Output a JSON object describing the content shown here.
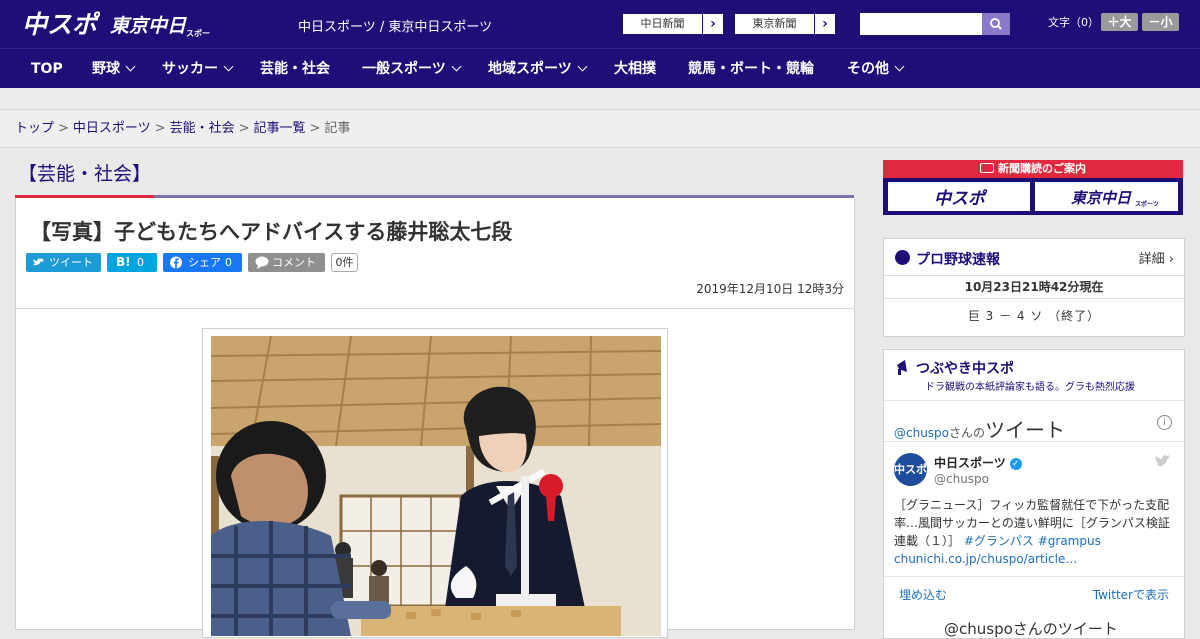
{
  "header": {
    "logo_chuspo": "中スポ",
    "logo_tokyo": "東京中日",
    "logo_tokyo_sub": "スポーツ",
    "site_title": "中日スポーツ / 東京中日スポーツ",
    "paper_buttons": [
      {
        "label": "中日新聞"
      },
      {
        "label": "東京新聞"
      }
    ],
    "search_placeholder": "",
    "font_size_label": "文字（0）",
    "font_larger": "＋大",
    "font_smaller": "－小"
  },
  "nav": {
    "items": [
      {
        "label": "TOP",
        "dropdown": false
      },
      {
        "label": "野球",
        "dropdown": true
      },
      {
        "label": "サッカー",
        "dropdown": true
      },
      {
        "label": "芸能・社会",
        "dropdown": false
      },
      {
        "label": "一般スポーツ",
        "dropdown": true
      },
      {
        "label": "地域スポーツ",
        "dropdown": true
      },
      {
        "label": "大相撲",
        "dropdown": false
      },
      {
        "label": "競馬・ボート・競輪",
        "dropdown": false
      },
      {
        "label": "その他",
        "dropdown": true
      }
    ]
  },
  "breadcrumb": {
    "items": [
      "トップ",
      "中日スポーツ",
      "芸能・社会",
      "記事一覧"
    ],
    "current": "記事"
  },
  "section": {
    "title": "【芸能・社会】"
  },
  "article": {
    "title": "【写真】子どもたちへアドバイスする藤井聡太七段",
    "share": {
      "twitter": "ツイート",
      "hatena": "B!",
      "hatena_count": "0",
      "facebook": "シェア",
      "facebook_count": "0",
      "comment": "コメント",
      "comment_count": "0件"
    },
    "date": "2019年12月10日 12時3分"
  },
  "sidebar": {
    "subscription_header": "新聞購読のご案内",
    "subscription_logo1": "中スポ",
    "subscription_logo2": "東京中日",
    "subscription_logo2_sub": "スポーツ",
    "baseball": {
      "title": "プロ野球速報",
      "detail": "詳細 ›",
      "time": "10月23日21時42分現在",
      "score": "巨 3 － 4 ソ （終了）"
    },
    "tweets": {
      "title": "つぶやき中スポ",
      "subtitle": "ドラ観戦の本紙評論家も語る。グラも熱烈応援",
      "handle": "@chuspo",
      "handle_suffix": "さんの",
      "heading": "ツイート",
      "account_name": "中日スポーツ",
      "account_user": "@chuspo",
      "avatar_text": "中スポ",
      "text": "［グラニュース］フィッカ監督就任で下がった支配率…風間サッカーとの違い鮮明に［グランパス検証連載（１）］",
      "tags": "#グランパス #grampus",
      "link": "chunichi.co.jp/chuspo/article…",
      "embed": "埋め込む",
      "view_on_twitter": "Twitterで表示",
      "footer": "@chuspoさんのツイート"
    }
  },
  "colors": {
    "brand": "#1d0e78",
    "accent": "#e1283e"
  }
}
